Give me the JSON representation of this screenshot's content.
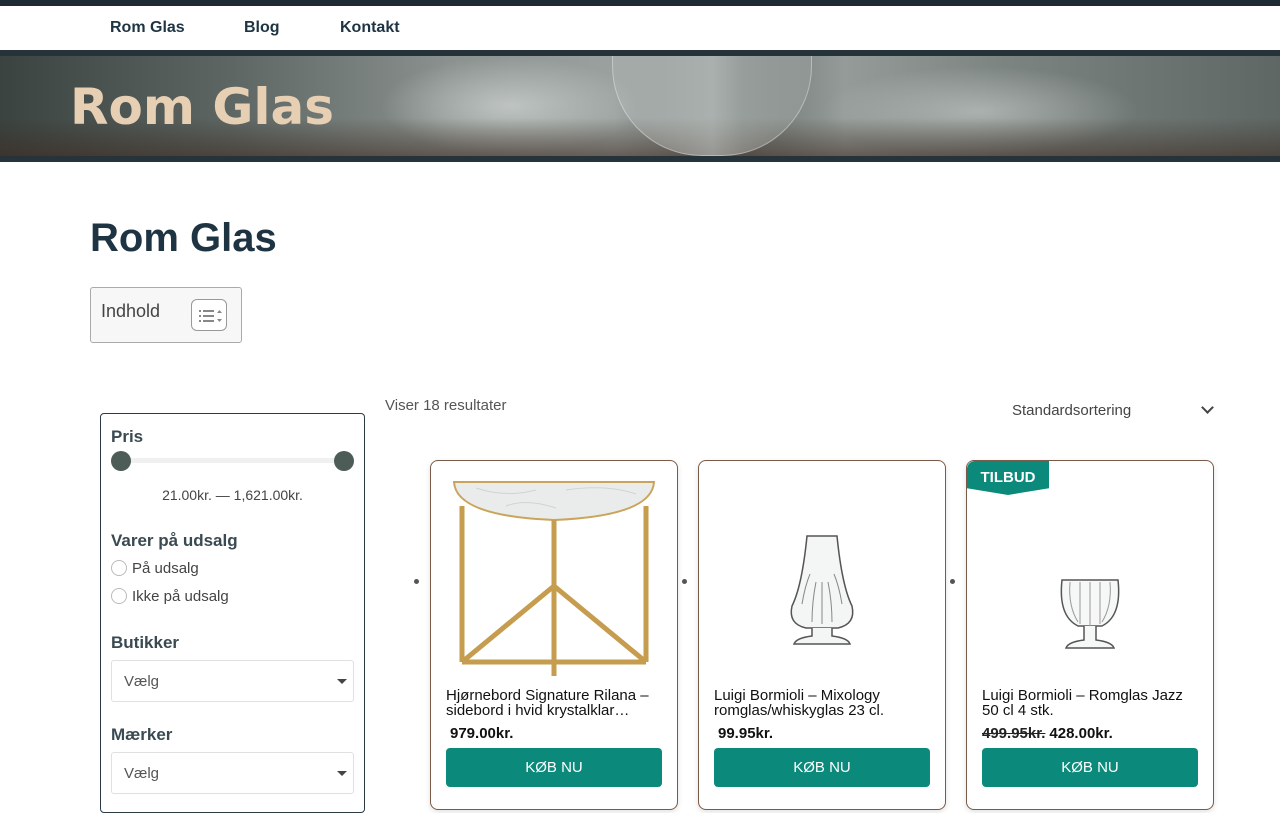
{
  "nav": {
    "items": [
      "Rom Glas",
      "Blog",
      "Kontakt"
    ]
  },
  "hero": {
    "title": "Rom Glas"
  },
  "page": {
    "title": "Rom Glas"
  },
  "toc": {
    "label": "Indhold"
  },
  "filter": {
    "price": {
      "heading": "Pris",
      "range_text": "21.00kr. — 1,621.00kr.",
      "min": 21.0,
      "max": 1621.0
    },
    "sale": {
      "heading": "Varer på udsalg",
      "options": [
        "På udsalg",
        "Ikke på udsalg"
      ]
    },
    "stores": {
      "heading": "Butikker",
      "selected": "Vælg"
    },
    "brands": {
      "heading": "Mærker",
      "selected": "Vælg"
    }
  },
  "results": {
    "count_text": "Viser 18 resultater",
    "sort_selected": "Standardsortering"
  },
  "products": [
    {
      "name_line1": "Hjørnebord Signature Rilana –",
      "name_line2": "sidebord i hvid krystalklar…",
      "price": "979.00kr.",
      "old_price": "",
      "buy_label": "KØB NU",
      "badge": ""
    },
    {
      "name_line1": "Luigi Bormioli – Mixology",
      "name_line2": "romglas/whiskyglas 23 cl.",
      "price": "99.95kr.",
      "old_price": "",
      "buy_label": "KØB NU",
      "badge": ""
    },
    {
      "name_line1": "Luigi Bormioli – Romglas Jazz",
      "name_line2": "50 cl 4 stk.",
      "price": "428.00kr.",
      "old_price": "499.95kr.",
      "buy_label": "KØB NU",
      "badge": "TILBUD"
    }
  ],
  "colors": {
    "accent": "#0b8a7b",
    "heading": "#1f3443",
    "hero_title": "#e7cfb4"
  }
}
